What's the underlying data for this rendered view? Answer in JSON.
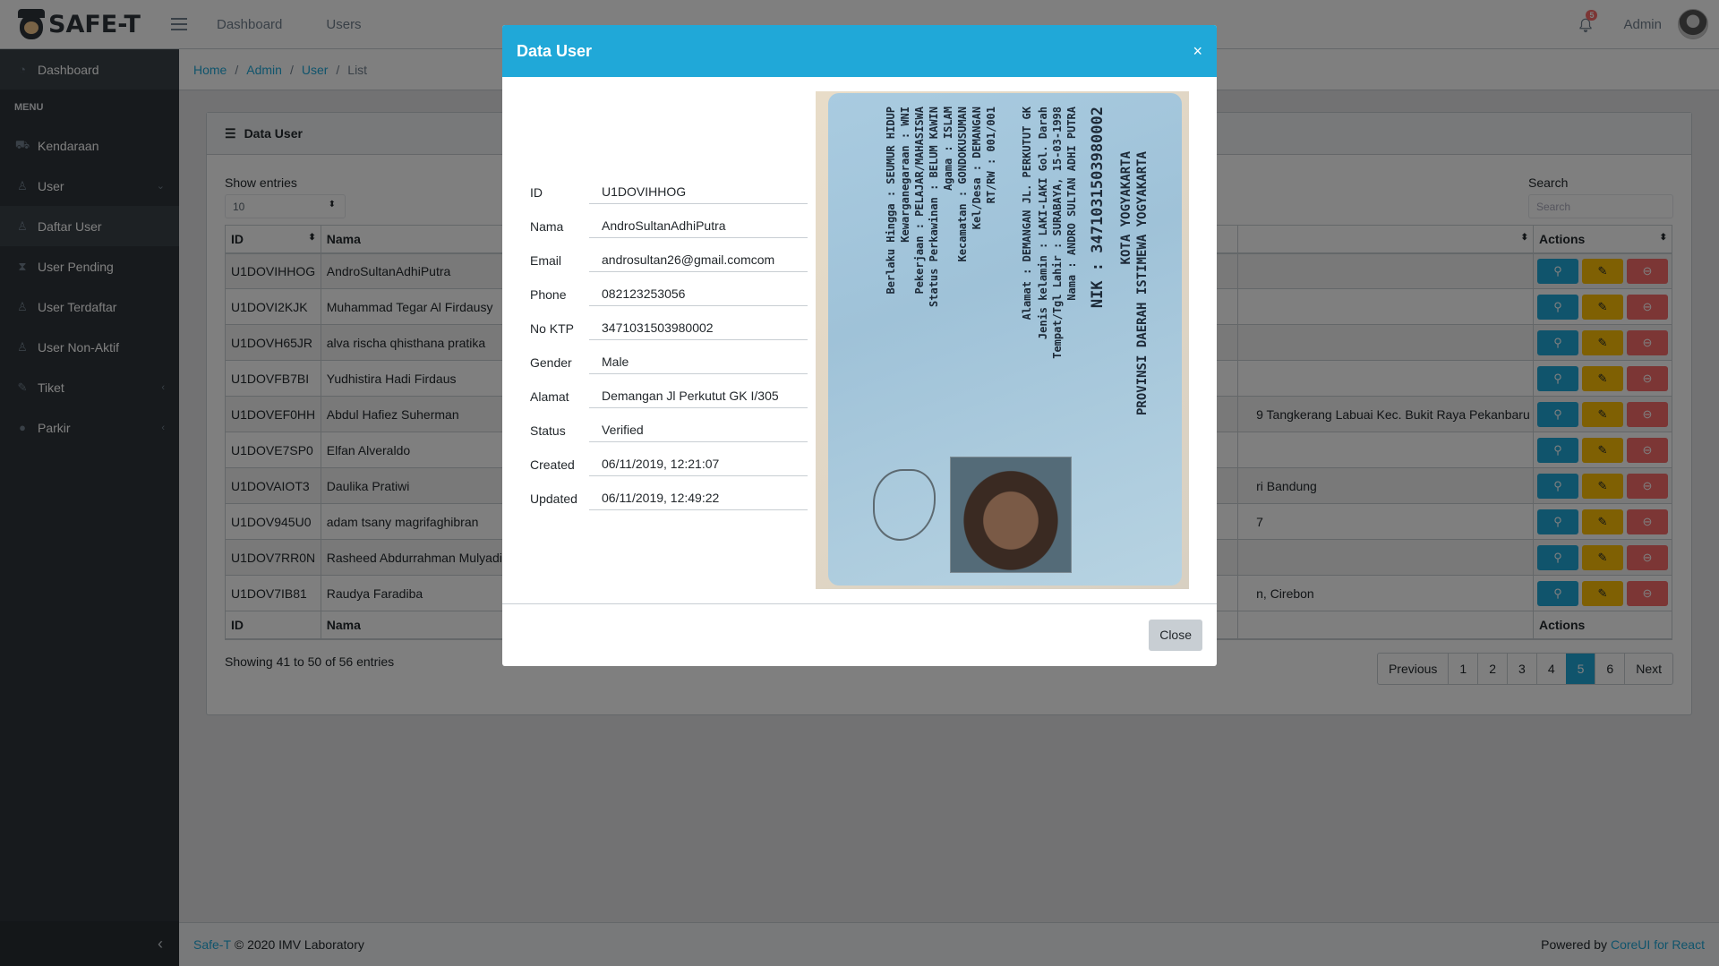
{
  "brand": {
    "name": "SAFE-T"
  },
  "header": {
    "nav": [
      "Dashboard",
      "Users"
    ],
    "notification_count": "5",
    "user_label": "Admin"
  },
  "sidebar": {
    "dashboard": "Dashboard",
    "menu_title": "MENU",
    "items": [
      {
        "label": "Kendaraan",
        "icon": "car-icon"
      },
      {
        "label": "User",
        "icon": "user-icon"
      },
      {
        "label": "Daftar User",
        "icon": "user-icon"
      },
      {
        "label": "User Pending",
        "icon": "hourglass-icon"
      },
      {
        "label": "User Terdaftar",
        "icon": "user-icon"
      },
      {
        "label": "User Non-Aktif",
        "icon": "user-icon"
      },
      {
        "label": "Tiket",
        "icon": "note-icon"
      },
      {
        "label": "Parkir",
        "icon": "circle-icon"
      }
    ]
  },
  "breadcrumb": [
    "Home",
    "Admin",
    "User",
    "List"
  ],
  "card": {
    "title": "Data User",
    "show_entries_label": "Show entries",
    "entries_value": "10",
    "search_label": "Search",
    "search_placeholder": "Search"
  },
  "table": {
    "headers": [
      "ID",
      "Nama",
      "",
      "Actions"
    ],
    "rows": [
      {
        "id": "U1DOVIHHOG",
        "nama": "AndroSultanAdhiPutra",
        "extra": ""
      },
      {
        "id": "U1DOVI2KJK",
        "nama": "Muhammad Tegar Al Firdausy",
        "extra": ""
      },
      {
        "id": "U1DOVH65JR",
        "nama": "alva rischa qhisthana pratika",
        "extra": ""
      },
      {
        "id": "U1DOVFB7BI",
        "nama": "Yudhistira Hadi Firdaus",
        "extra": ""
      },
      {
        "id": "U1DOVEF0HH",
        "nama": "Abdul Hafiez Suherman",
        "extra": "9 Tangkerang Labuai Kec. Bukit Raya Pekanbaru"
      },
      {
        "id": "U1DOVE7SP0",
        "nama": "Elfan Alveraldo",
        "extra": ""
      },
      {
        "id": "U1DOVAIOT3",
        "nama": "Daulika Pratiwi",
        "extra": "ri Bandung"
      },
      {
        "id": "U1DOV945U0",
        "nama": "adam tsany magrifaghibran",
        "extra": "7"
      },
      {
        "id": "U1DOV7RR0N",
        "nama": "Rasheed Abdurrahman Mulyadi",
        "extra": ""
      },
      {
        "id": "U1DOV7IB81",
        "nama": "Raudya Faradiba",
        "extra": "n, Cirebon"
      }
    ],
    "footer_headers": [
      "ID",
      "Nama",
      "",
      "Actions"
    ]
  },
  "pagination": {
    "showing": "Showing 41 to 50 of 56 entries",
    "previous": "Previous",
    "pages": [
      "1",
      "2",
      "3",
      "4",
      "5",
      "6"
    ],
    "active_page": "5",
    "next": "Next"
  },
  "footer": {
    "brand_link": "Safe-T",
    "copyright": "© 2020 IMV Laboratory",
    "powered_by": "Powered by",
    "powered_link": "CoreUI for React"
  },
  "modal": {
    "title": "Data User",
    "close_label": "Close",
    "fields": [
      {
        "label": "ID",
        "value": "U1DOVIHHOG"
      },
      {
        "label": "Nama",
        "value": "AndroSultanAdhiPutra"
      },
      {
        "label": "Email",
        "value": "androsultan26@gmail.comcom"
      },
      {
        "label": "Phone",
        "value": "082123253056"
      },
      {
        "label": "No KTP",
        "value": "3471031503980002"
      },
      {
        "label": "Gender",
        "value": "Male"
      },
      {
        "label": "Alamat",
        "value": "Demangan Jl Perkutut GK I/305"
      },
      {
        "label": "Status",
        "value": "Verified"
      },
      {
        "label": "Created",
        "value": "06/11/2019, 12:21:07"
      },
      {
        "label": "Updated",
        "value": "06/11/2019, 12:49:22"
      }
    ],
    "ktp_lines": [
      "PROVINSI DAERAH ISTIMEWA YOGYAKARTA",
      "KOTA YOGYAKARTA",
      "NIK : 3471031503980002",
      "Nama : ANDRO SULTAN ADHI PUTRA",
      "Tempat/Tgl Lahir : SURABAYA, 15-03-1998",
      "Jenis kelamin : LAKI-LAKI   Gol. Darah",
      "Alamat : DEMANGAN JL. PERKUTUT GK",
      "RT/RW : 001/001",
      "Kel/Desa : DEMANGAN",
      "Kecamatan : GONDOKUSUMAN",
      "Agama : ISLAM",
      "Status Perkawinan : BELUM KAWIN",
      "Pekerjaan : PELAJAR/MAHASISWA",
      "Kewarganegaraan : WNI",
      "Berlaku Hingga : SEUMUR HIDUP"
    ]
  }
}
